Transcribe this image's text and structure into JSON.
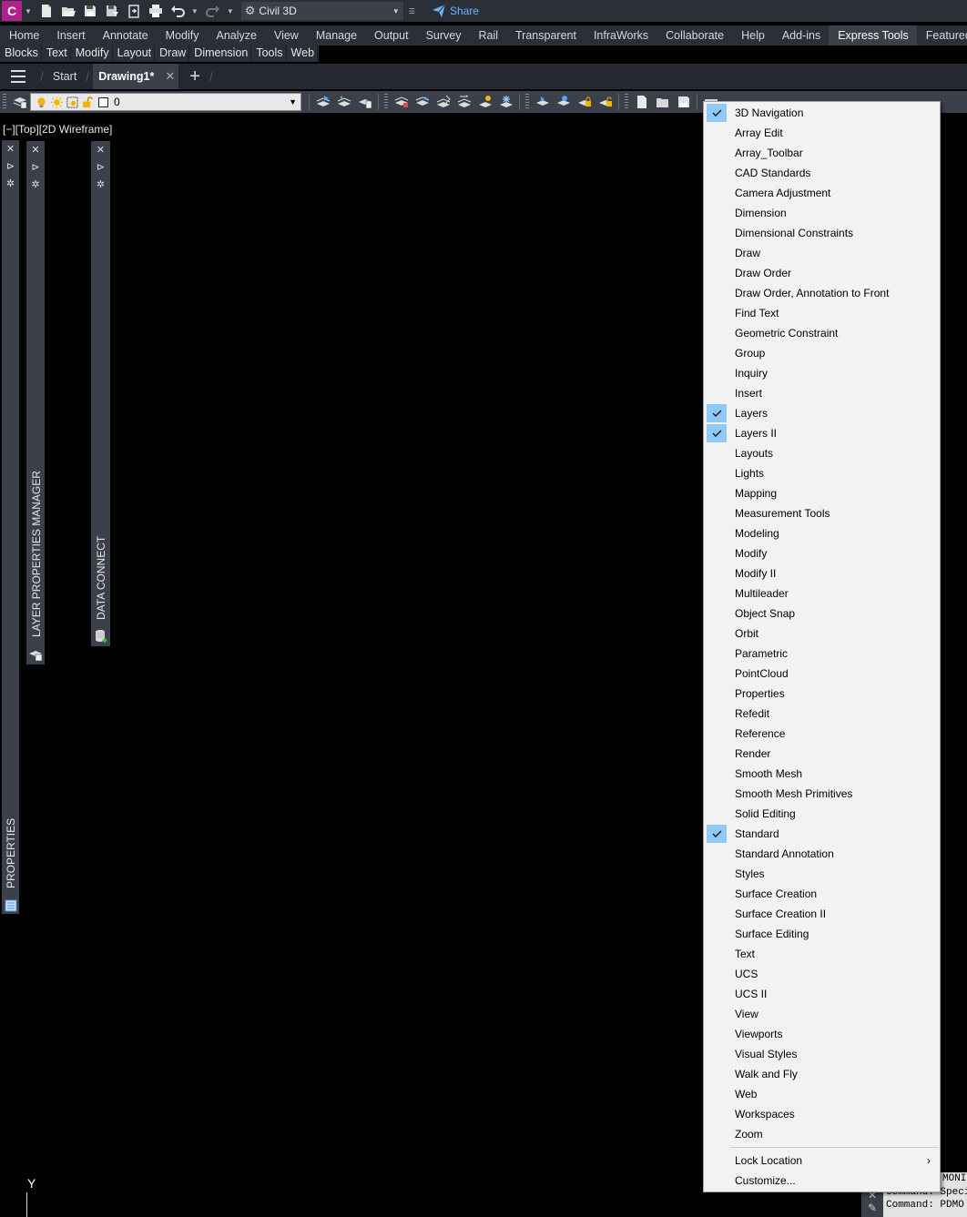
{
  "app": {
    "logo_letter": "C",
    "workspace": "Civil 3D",
    "share_label": "Share"
  },
  "ribbon_tabs": [
    "Home",
    "Insert",
    "Annotate",
    "Modify",
    "Analyze",
    "View",
    "Manage",
    "Output",
    "Survey",
    "Rail",
    "Transparent",
    "InfraWorks",
    "Collaborate",
    "Help",
    "Add-ins",
    "Express Tools",
    "Featured Ap"
  ],
  "ribbon_active_tab": "Express Tools",
  "menubar": [
    "Blocks",
    "Text",
    "Modify",
    "Layout",
    "Draw",
    "Dimension",
    "Tools",
    "Web"
  ],
  "file_tabs": {
    "start": "Start",
    "drawing": "Drawing1*",
    "close_glyph": "✕",
    "new_glyph": "+"
  },
  "layer_combo": {
    "value": "0"
  },
  "viewport_label": "[−][Top][2D Wireframe]",
  "palettes": {
    "properties": "PROPERTIES",
    "layer_manager": "LAYER PROPERTIES MANAGER",
    "data_connect": "DATA CONNECT"
  },
  "ucs": {
    "y_label": "Y"
  },
  "command_line": {
    "lines": [
      "MONITOR",
      "Command: Specify",
      "Command: PDMO"
    ]
  },
  "context_menu": {
    "items": [
      {
        "label": "3D Navigation",
        "checked": true
      },
      {
        "label": "Array Edit",
        "checked": false
      },
      {
        "label": "Array_Toolbar",
        "checked": false
      },
      {
        "label": "CAD Standards",
        "checked": false
      },
      {
        "label": "Camera Adjustment",
        "checked": false
      },
      {
        "label": "Dimension",
        "checked": false
      },
      {
        "label": "Dimensional Constraints",
        "checked": false
      },
      {
        "label": "Draw",
        "checked": false
      },
      {
        "label": "Draw Order",
        "checked": false
      },
      {
        "label": "Draw Order, Annotation to Front",
        "checked": false
      },
      {
        "label": "Find Text",
        "checked": false
      },
      {
        "label": "Geometric Constraint",
        "checked": false
      },
      {
        "label": "Group",
        "checked": false
      },
      {
        "label": "Inquiry",
        "checked": false
      },
      {
        "label": "Insert",
        "checked": false
      },
      {
        "label": "Layers",
        "checked": true
      },
      {
        "label": "Layers II",
        "checked": true
      },
      {
        "label": "Layouts",
        "checked": false
      },
      {
        "label": "Lights",
        "checked": false
      },
      {
        "label": "Mapping",
        "checked": false
      },
      {
        "label": "Measurement Tools",
        "checked": false
      },
      {
        "label": "Modeling",
        "checked": false
      },
      {
        "label": "Modify",
        "checked": false
      },
      {
        "label": "Modify II",
        "checked": false
      },
      {
        "label": "Multileader",
        "checked": false
      },
      {
        "label": "Object Snap",
        "checked": false
      },
      {
        "label": "Orbit",
        "checked": false
      },
      {
        "label": "Parametric",
        "checked": false
      },
      {
        "label": "PointCloud",
        "checked": false
      },
      {
        "label": "Properties",
        "checked": false
      },
      {
        "label": "Refedit",
        "checked": false
      },
      {
        "label": "Reference",
        "checked": false
      },
      {
        "label": "Render",
        "checked": false
      },
      {
        "label": "Smooth Mesh",
        "checked": false
      },
      {
        "label": "Smooth Mesh Primitives",
        "checked": false
      },
      {
        "label": "Solid Editing",
        "checked": false
      },
      {
        "label": "Standard",
        "checked": true
      },
      {
        "label": "Standard Annotation",
        "checked": false
      },
      {
        "label": "Styles",
        "checked": false
      },
      {
        "label": "Surface Creation",
        "checked": false
      },
      {
        "label": "Surface Creation II",
        "checked": false
      },
      {
        "label": "Surface Editing",
        "checked": false
      },
      {
        "label": "Text",
        "checked": false
      },
      {
        "label": "UCS",
        "checked": false
      },
      {
        "label": "UCS II",
        "checked": false
      },
      {
        "label": "View",
        "checked": false
      },
      {
        "label": "Viewports",
        "checked": false
      },
      {
        "label": "Visual Styles",
        "checked": false
      },
      {
        "label": "Walk and Fly",
        "checked": false
      },
      {
        "label": "Web",
        "checked": false
      },
      {
        "label": "Workspaces",
        "checked": false
      },
      {
        "label": "Zoom",
        "checked": false
      }
    ],
    "footer_items": [
      {
        "label": "Lock Location",
        "submenu": true,
        "arrow": "›"
      },
      {
        "label": "Customize...",
        "submenu": false
      }
    ]
  },
  "colors": {
    "logo": "#b0218a",
    "check_highlight": "#90c8f6",
    "share": "#6cb4ff",
    "panel": "#3b404b",
    "canvas": "#000000"
  }
}
